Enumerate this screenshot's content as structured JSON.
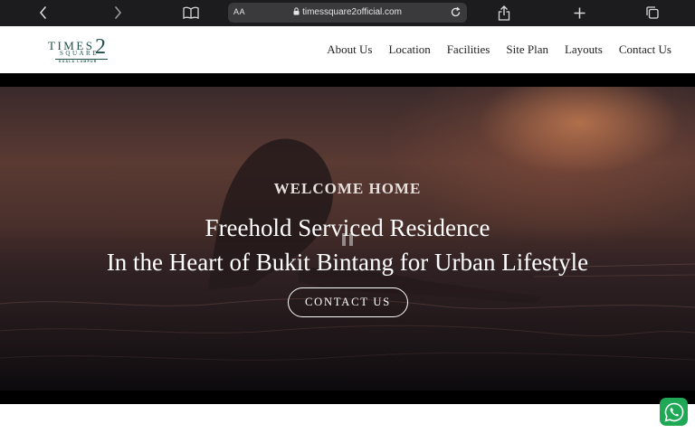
{
  "browser": {
    "text_size_label": "AA",
    "url": "timessquare2official.com"
  },
  "logo": {
    "word_top": "TIMES",
    "numeral": "2",
    "word_bottom": "SQUARE",
    "tagline": "KUALA LUMPUR"
  },
  "nav": {
    "items": [
      {
        "label": "About Us"
      },
      {
        "label": "Location"
      },
      {
        "label": "Facilities"
      },
      {
        "label": "Site Plan"
      },
      {
        "label": "Layouts"
      },
      {
        "label": "Contact Us"
      }
    ]
  },
  "hero": {
    "eyebrow": "WELCOME HOME",
    "headline_line1": "Freehold Serviced Residence",
    "headline_line2": "In the Heart of Bukit Bintang for Urban Lifestyle",
    "cta_label": "CONTACT US"
  },
  "icons": {
    "back": "chevron-left-icon",
    "forward": "chevron-right-icon",
    "bookmarks": "book-icon",
    "lock": "lock-icon",
    "reload": "reload-icon",
    "share": "share-icon",
    "new_tab": "plus-icon",
    "tabs": "tabs-icon",
    "pause": "pause-icon",
    "whatsapp": "whatsapp-icon"
  },
  "colors": {
    "brand": "#1f4f4a",
    "whatsapp": "#1fa855"
  }
}
